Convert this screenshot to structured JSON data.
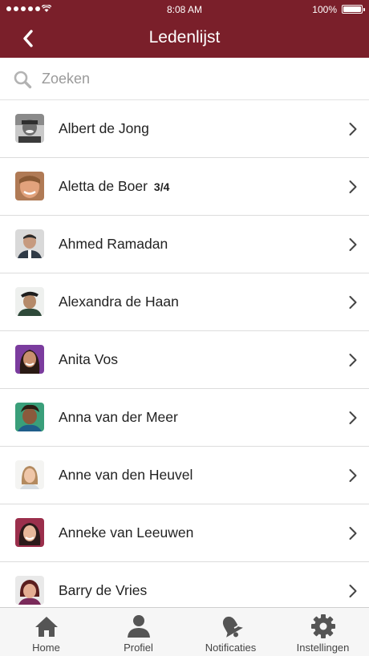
{
  "status_bar": {
    "time": "8:08 AM",
    "battery": "100%"
  },
  "header": {
    "title": "Ledenlijst",
    "back_icon": "chevron-left-icon"
  },
  "search": {
    "placeholder": "Zoeken",
    "value": "",
    "icon": "search-icon"
  },
  "members": [
    {
      "name": "Albert de Jong",
      "badge": ""
    },
    {
      "name": "Aletta de Boer",
      "badge": "3/4"
    },
    {
      "name": "Ahmed Ramadan",
      "badge": ""
    },
    {
      "name": "Alexandra de Haan",
      "badge": ""
    },
    {
      "name": "Anita Vos",
      "badge": ""
    },
    {
      "name": "Anna van der Meer",
      "badge": ""
    },
    {
      "name": "Anne van den Heuvel",
      "badge": ""
    },
    {
      "name": "Anneke van Leeuwen",
      "badge": ""
    },
    {
      "name": "Barry de Vries",
      "badge": ""
    }
  ],
  "tabbar": {
    "home": {
      "label": "Home",
      "icon": "home-icon"
    },
    "profile": {
      "label": "Profiel",
      "icon": "user-icon"
    },
    "notifications": {
      "label": "Notificaties",
      "icon": "bell-icon"
    },
    "settings": {
      "label": "Instellingen",
      "icon": "gear-icon"
    }
  },
  "colors": {
    "header_bg": "#7a1f2a",
    "header_text": "#ffffff",
    "tabbar_bg": "#f6f6f6",
    "icon_gray": "#555555"
  }
}
